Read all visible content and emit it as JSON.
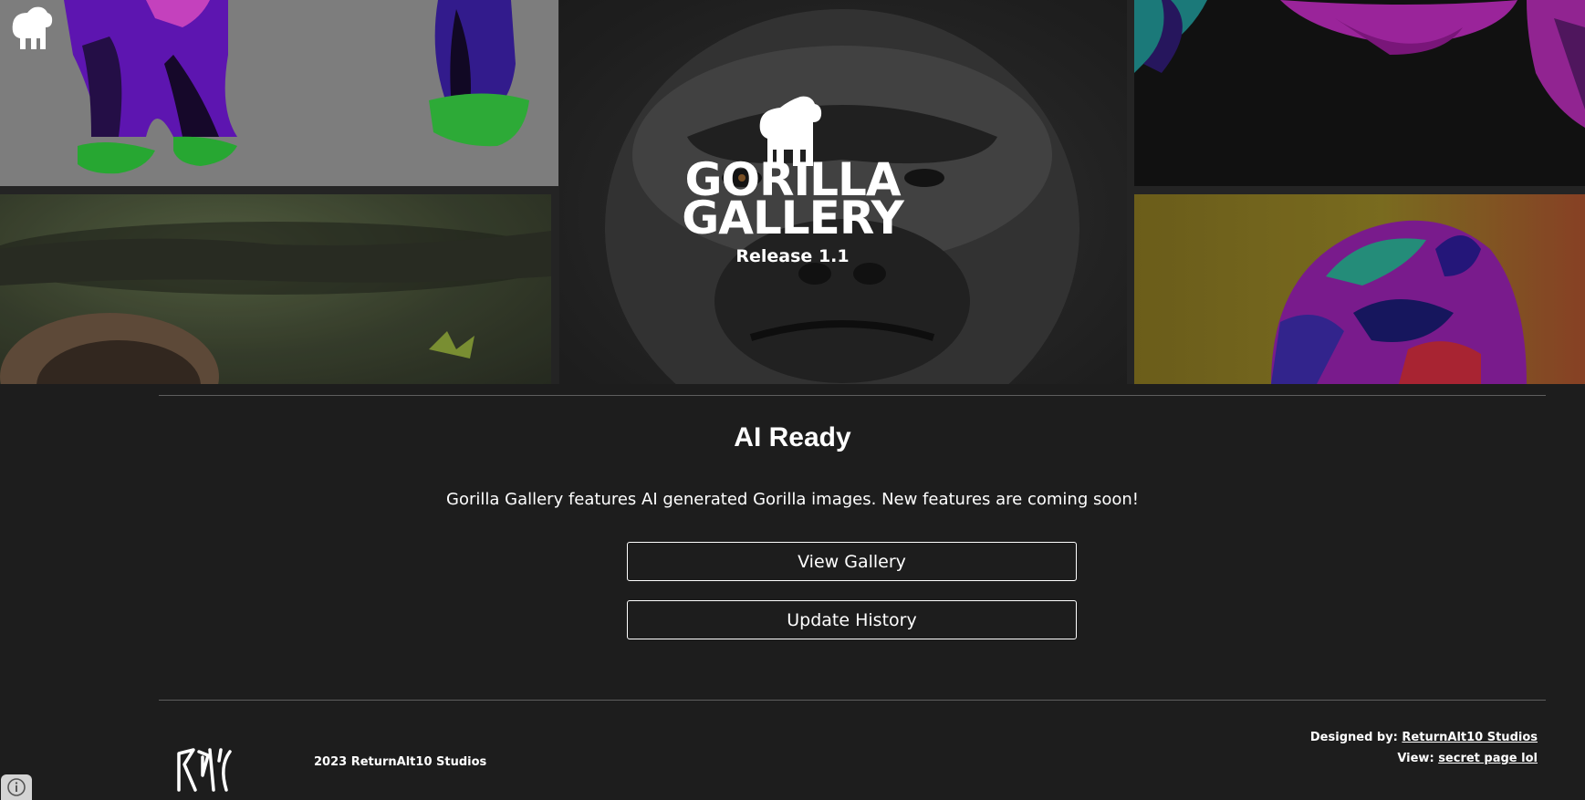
{
  "hero": {
    "logo_icon": "gorilla-icon",
    "title_line1": "GORILLA",
    "title_line2": "GALLERY",
    "release": "Release 1.1"
  },
  "main": {
    "heading": "AI Ready",
    "description": "Gorilla Gallery features AI generated Gorilla images. New features are coming soon!",
    "view_gallery_label": "View Gallery",
    "update_history_label": "Update History"
  },
  "footer": {
    "copyright": "2023 ReturnAlt10 Studios",
    "designed_by_label": "Designed by:",
    "designed_by_link": "ReturnAlt10 Studios",
    "view_label": "View:",
    "view_link": "secret page lol",
    "logo_icon": "returnalt10-logo",
    "info_icon": "info-icon"
  },
  "colors": {
    "background": "#1d1d1d",
    "text": "#ffffff",
    "divider": "#5e5e5e"
  }
}
